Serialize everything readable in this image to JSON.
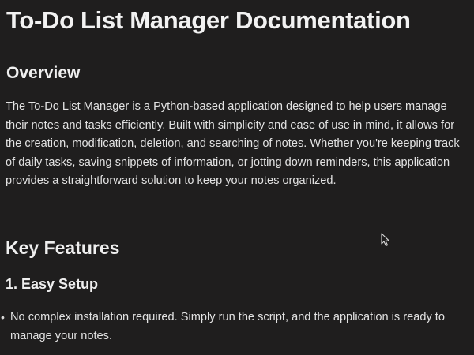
{
  "doc": {
    "title": "To-Do List Manager Documentation",
    "overview": {
      "heading": "Overview",
      "body": "The To-Do List Manager is a Python-based application designed to help users manage their notes and tasks efficiently. Built with simplicity and ease of use in mind, it allows for the creation, modification, deletion, and searching of notes. Whether you're keeping track of daily tasks, saving snippets of information, or jotting down reminders, this application provides a straightforward solution to keep your notes organized."
    },
    "key_features": {
      "heading": "Key Features",
      "items": [
        {
          "heading": "1. Easy Setup",
          "bullets": [
            "No complex installation required. Simply run the script, and the application is ready to manage your notes."
          ]
        }
      ]
    }
  },
  "pointer": {
    "icon": "mouse-pointer-icon"
  },
  "colors": {
    "background": "#1f1e1e",
    "text": "#e2e2e2",
    "heading": "#f2f2f2"
  }
}
